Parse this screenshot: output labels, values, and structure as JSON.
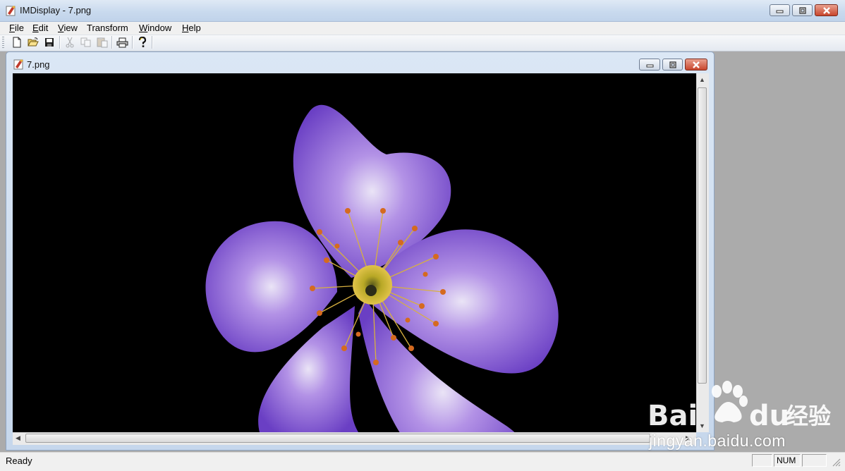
{
  "window": {
    "title": "IMDisplay - 7.png",
    "buttons": [
      "minimize",
      "maximize",
      "close"
    ]
  },
  "menubar": {
    "items": [
      {
        "label": "File",
        "mnemonic": "F"
      },
      {
        "label": "Edit",
        "mnemonic": "E"
      },
      {
        "label": "View",
        "mnemonic": "V"
      },
      {
        "label": "Transform",
        "mnemonic": ""
      },
      {
        "label": "Window",
        "mnemonic": "W"
      },
      {
        "label": "Help",
        "mnemonic": "H"
      }
    ]
  },
  "toolbar": {
    "buttons": [
      {
        "name": "new",
        "icon": "new-document-icon",
        "enabled": true
      },
      {
        "name": "open",
        "icon": "open-folder-icon",
        "enabled": true
      },
      {
        "name": "save",
        "icon": "save-disk-icon",
        "enabled": true
      },
      {
        "name": "cut",
        "icon": "cut-scissors-icon",
        "enabled": false
      },
      {
        "name": "copy",
        "icon": "copy-icon",
        "enabled": false
      },
      {
        "name": "paste",
        "icon": "paste-icon",
        "enabled": false
      },
      {
        "name": "print",
        "icon": "printer-icon",
        "enabled": true
      },
      {
        "name": "help",
        "icon": "help-icon",
        "enabled": true
      }
    ]
  },
  "child_window": {
    "title": "7.png",
    "image": {
      "subject": "purple flower",
      "background_color": "#000000",
      "petal_color": "#8a55d6",
      "center_color": "#d8a928"
    }
  },
  "statusbar": {
    "text": "Ready",
    "panes": [
      "",
      "NUM",
      ""
    ]
  },
  "watermark": {
    "logo_text": "Bai du 经验",
    "site": "jingyan.baidu.com"
  },
  "colors": {
    "titlebar": "#c9daee",
    "close_button": "#c8462d",
    "mdi_background": "#ABABAB",
    "menu_background": "#f0f0f0"
  }
}
